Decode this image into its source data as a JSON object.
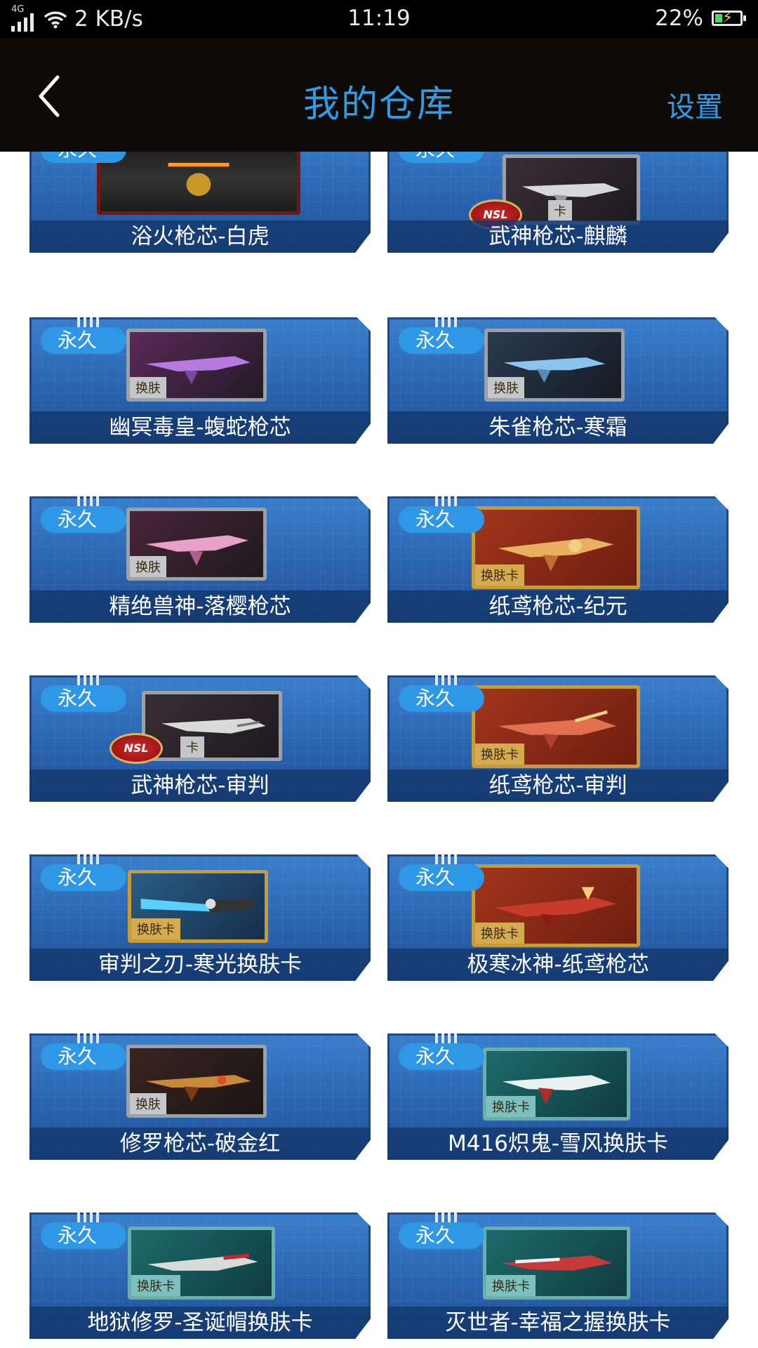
{
  "status_bar": {
    "network": "4G",
    "speed": "2 KB/s",
    "time": "11:19",
    "battery": "22%"
  },
  "header": {
    "title": "我的仓库",
    "settings_label": "设置"
  },
  "colors": {
    "accent": "#2e9de6",
    "header_bg": "#0d0a08",
    "card_blue": "#2a64b0"
  },
  "items": [
    {
      "badge": "永久",
      "name": "浴火枪芯-白虎"
    },
    {
      "badge": "永久",
      "name": "武神枪芯-麒麟",
      "tag": "卡"
    },
    {
      "badge": "永久",
      "name": "幽冥毒皇-蝮蛇枪芯",
      "tag": "换肤"
    },
    {
      "badge": "永久",
      "name": "朱雀枪芯-寒霜",
      "tag": "换肤"
    },
    {
      "badge": "永久",
      "name": "精绝兽神-落樱枪芯",
      "tag": "换肤"
    },
    {
      "badge": "永久",
      "name": "纸鸢枪芯-纪元",
      "tag": "换肤卡"
    },
    {
      "badge": "永久",
      "name": "武神枪芯-审判",
      "tag": "卡"
    },
    {
      "badge": "永久",
      "name": "纸鸢枪芯-审判",
      "tag": "换肤卡"
    },
    {
      "badge": "永久",
      "name": "审判之刃-寒光换肤卡",
      "tag": "换肤卡"
    },
    {
      "badge": "永久",
      "name": "极寒冰神-纸鸢枪芯",
      "tag": "换肤卡"
    },
    {
      "badge": "永久",
      "name": "修罗枪芯-破金红",
      "tag": "换肤"
    },
    {
      "badge": "永久",
      "name": "M416炽鬼-雪风换肤卡",
      "tag": "换肤卡"
    },
    {
      "badge": "永久",
      "name": "地狱修罗-圣诞帽换肤卡",
      "tag": "换肤卡"
    },
    {
      "badge": "永久",
      "name": "灭世者-幸福之握换肤卡",
      "tag": "换肤卡"
    }
  ]
}
